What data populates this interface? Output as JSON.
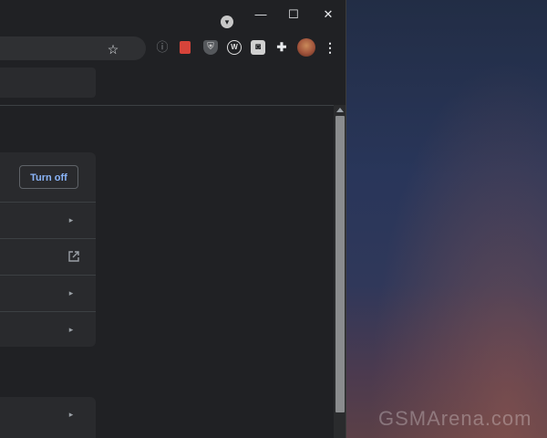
{
  "window": {
    "controls": {
      "minimize": "—",
      "maximize": "☐",
      "close": "✕"
    },
    "tab_search_icon": "chevron-down-circle"
  },
  "toolbar": {
    "star_icon": "☆",
    "extensions": [
      {
        "name": "info-icon",
        "glyph": "ⓘ"
      },
      {
        "name": "red-book-extension-icon",
        "glyph": ""
      },
      {
        "name": "shield-extension-icon",
        "glyph": "⛨"
      },
      {
        "name": "w-extension-icon",
        "glyph": "W"
      },
      {
        "name": "camera-extension-icon",
        "glyph": "◙"
      },
      {
        "name": "puzzle-icon",
        "glyph": "✚"
      },
      {
        "name": "profile-avatar",
        "glyph": ""
      },
      {
        "name": "menu-icon",
        "glyph": "⋮"
      }
    ]
  },
  "settings": {
    "turn_off_label": "Turn off",
    "chevron_glyph": "▸"
  },
  "watermark": "GSMArena.com",
  "colors": {
    "background": "#202124",
    "card": "#292a2d",
    "accent": "#8ab4f8"
  }
}
